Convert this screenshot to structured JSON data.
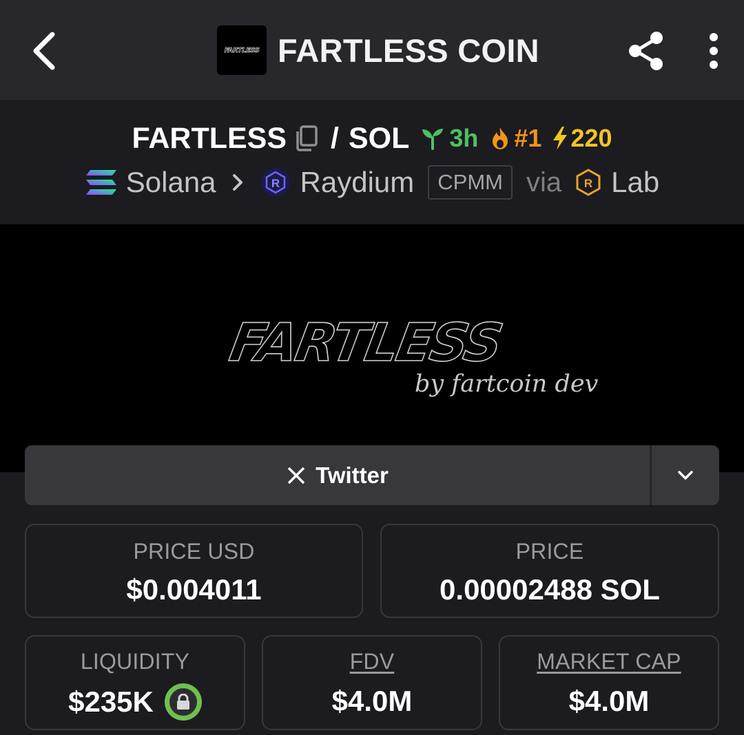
{
  "header": {
    "title": "FARTLESS COIN",
    "token_logo_text": "FARTLESS",
    "icons": {
      "back": "back-arrow-icon",
      "share": "share-icon",
      "more": "more-vertical-icon"
    }
  },
  "pair": {
    "base": "FARTLESS",
    "separator": "/",
    "quote": "SOL",
    "age": "3h",
    "rank": "#1",
    "boosts": "220",
    "colors": {
      "age": "#4ec063",
      "rank": "#f2941a",
      "boosts": "#f3c423"
    }
  },
  "route": {
    "chain": "Solana",
    "dex": "Raydium",
    "pool_type": "CPMM",
    "via_label": "via",
    "launchpad": "Lab"
  },
  "banner": {
    "title": "FARTLESS",
    "subtitle": "by fartcoin dev"
  },
  "social": {
    "label": "Twitter",
    "icon": "x-logo-icon"
  },
  "stats": {
    "price_usd": {
      "label": "PRICE USD",
      "value": "$0.004011"
    },
    "price_native": {
      "label": "PRICE",
      "value": "0.00002488 SOL"
    },
    "liquidity": {
      "label": "LIQUIDITY",
      "value": "$235K",
      "locked": true
    },
    "fdv": {
      "label": "FDV",
      "value": "$4.0M"
    },
    "market_cap": {
      "label": "MARKET CAP",
      "value": "$4.0M"
    }
  },
  "theme": {
    "background": "#1b1b20",
    "toolbar": "#27272c",
    "card_border": "#37373d",
    "lock_ring": "#6fc04f"
  }
}
